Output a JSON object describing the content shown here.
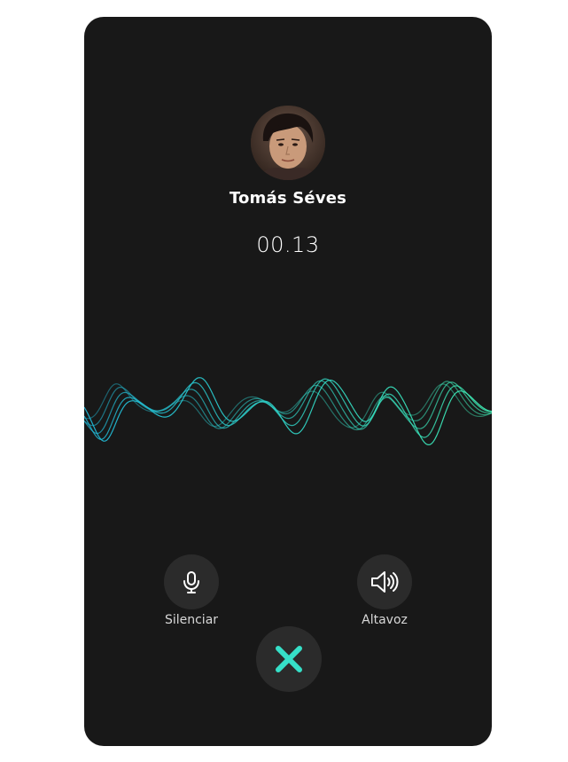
{
  "caller": {
    "name": "Tomás Séves",
    "avatar_icon": "person-photo"
  },
  "call": {
    "timer": "00.13"
  },
  "controls": {
    "mute": {
      "label": "Silenciar",
      "icon": "microphone-icon"
    },
    "speaker": {
      "label": "Altavoz",
      "icon": "speaker-icon"
    },
    "hangup": {
      "icon": "close-icon"
    }
  },
  "colors": {
    "background": "#181818",
    "button": "#2b2b2b",
    "wave_start": "#1fb6d6",
    "wave_end": "#3ee8b0",
    "hangup_accent": "#36e0c8"
  }
}
